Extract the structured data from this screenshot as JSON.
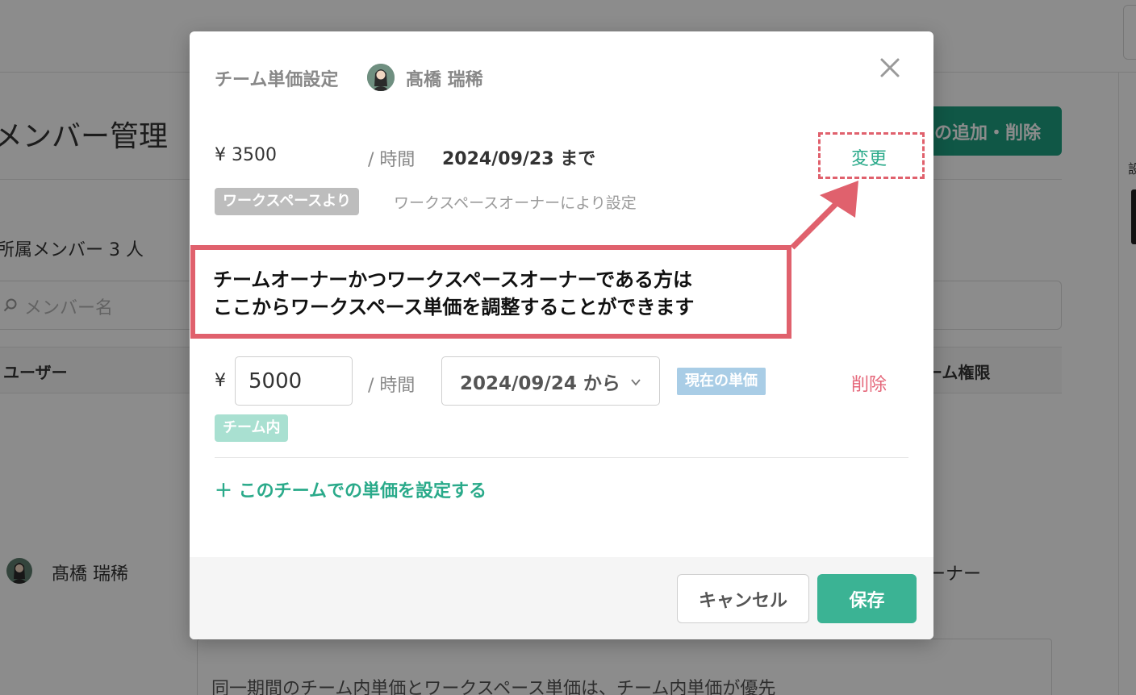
{
  "background": {
    "page_title": "メンバー管理",
    "add_remove_button": "の追加・削除",
    "member_count": "所属メンバー 3 人",
    "search_placeholder": "メンバー名",
    "col_user": "ユーザー",
    "col_permission": "ーム権限",
    "user_name": "髙橋 瑞稀",
    "user_role": "ーナー",
    "note": "同一期間のチーム内単価とワークスペース単価は、チーム内単価が優先",
    "right_edge_char": "設"
  },
  "modal": {
    "title": "チーム単価設定",
    "user_name": "髙橋 瑞稀",
    "workspace_rate": {
      "price": "¥ 3500",
      "per": "/ 時間",
      "until": "2024/09/23 まで",
      "change_label": "変更",
      "tag": "ワークスペースより",
      "tag_desc": "ワークスペースオーナーにより設定"
    },
    "team_rate": {
      "yen": "¥",
      "value": "5000",
      "per": "/ 時間",
      "date": "2024/09/24 から",
      "current_badge": "現在の単価",
      "delete_label": "削除",
      "tag": "チーム内"
    },
    "add_link": "＋ このチームでの単価を設定する",
    "cancel_label": "キャンセル",
    "save_label": "保存"
  },
  "annotation": {
    "line1": "チームオーナーかつワークスペースオーナーである方は",
    "line2": "ここからワークスペース単価を調整することができます"
  },
  "colors": {
    "accent_green": "#2aaa8a",
    "save_button": "#3bb394",
    "danger": "#e5677a",
    "annotation_red": "#e0616d",
    "current_badge": "#a9cde6",
    "team_tag": "#a9e0d1",
    "workspace_tag": "#bdbdbd"
  },
  "icons": [
    "close-icon",
    "chevron-down-icon",
    "search-icon",
    "avatar"
  ]
}
